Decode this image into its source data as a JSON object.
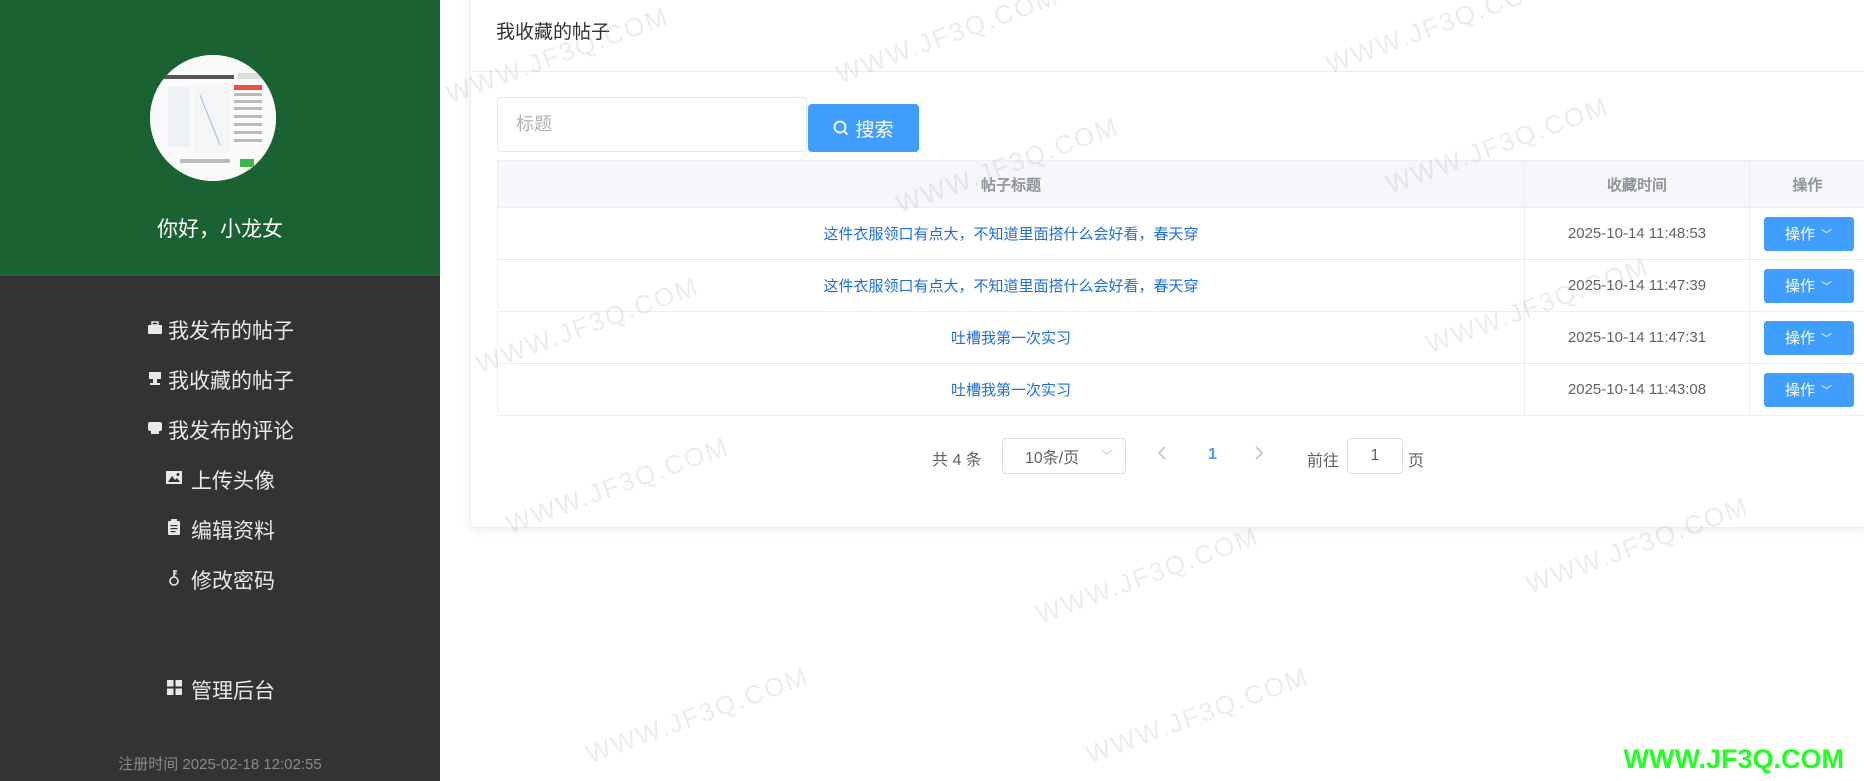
{
  "sidebar": {
    "greeting": "你好，小龙女",
    "items": [
      {
        "icon": "briefcase-icon",
        "glyph": "💼",
        "label": "我发布的帖子"
      },
      {
        "icon": "stamp-icon",
        "glyph": "⛾",
        "label": "我收藏的帖子"
      },
      {
        "icon": "comment-icon",
        "glyph": "💬",
        "label": "我发布的评论"
      },
      {
        "icon": "picture-icon",
        "glyph": "🖼",
        "label": "上传头像"
      },
      {
        "icon": "clipboard-icon",
        "glyph": "📋",
        "label": "编辑资料"
      },
      {
        "icon": "key-icon",
        "glyph": "⚷",
        "label": "修改密码"
      }
    ],
    "admin": {
      "icon": "grid-icon",
      "label": "管理后台"
    },
    "register_time": "注册时间 2025-02-18 12:02:55"
  },
  "card": {
    "title": "我收藏的帖子",
    "search": {
      "placeholder": "标题",
      "value": "",
      "button": "搜索"
    }
  },
  "table": {
    "columns": [
      "帖子标题",
      "收藏时间",
      "操作"
    ],
    "rows": [
      {
        "title": "这件衣服领口有点大，不知道里面搭什么会好看，春天穿",
        "time": "2025-10-14 11:48:53",
        "action": "操作"
      },
      {
        "title": "这件衣服领口有点大，不知道里面搭什么会好看，春天穿",
        "time": "2025-10-14 11:47:39",
        "action": "操作"
      },
      {
        "title": "吐槽我第一次实习",
        "time": "2025-10-14 11:47:31",
        "action": "操作"
      },
      {
        "title": "吐槽我第一次实习",
        "time": "2025-10-14 11:43:08",
        "action": "操作"
      }
    ]
  },
  "pagination": {
    "total": "共 4 条",
    "page_size": "10条/页",
    "current_page": "1",
    "goto_label": "前往",
    "goto_value": "1",
    "goto_suffix": "页"
  },
  "watermark": "WWW.JF3Q.COM",
  "colors": {
    "profile_bg": "#1b6232",
    "sidebar_bg": "#333333",
    "primary": "#409eff",
    "link": "#1e6fd9",
    "watermark_corner": "#22ff22"
  }
}
